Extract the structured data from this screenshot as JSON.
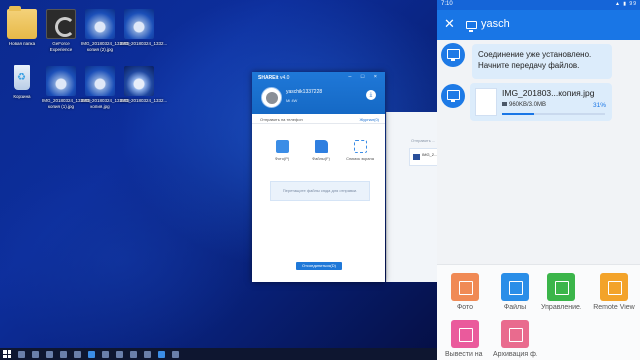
{
  "desktop": {
    "icons": [
      {
        "label": "Новая папка",
        "kind": "folder"
      },
      {
        "label": "GeForce Experience",
        "kind": "gfe"
      },
      {
        "label": "IMG_20180324_133208-копия (2).jpg",
        "kind": "photo"
      },
      {
        "label": "IMG_20180324_1332...",
        "kind": "photo"
      },
      {
        "label": "Корзина",
        "kind": "bin"
      },
      {
        "label": "IMG_20180324_133208-копия (1).jpg",
        "kind": "photo"
      },
      {
        "label": "IMG_20180324_133208-копия.jpg",
        "kind": "photo"
      },
      {
        "label": "IMG_20180324_1332...",
        "kind": "photo"
      }
    ]
  },
  "shareit": {
    "title": "SHAREit",
    "version": "v4.0",
    "controls": "– □ ×",
    "username": "yaschik1337228",
    "user_id": "Mi 4W",
    "receive_icon": "download-icon",
    "send_to_phone": "Отправить на телефон",
    "journal": "Журнал(0)",
    "actions": [
      {
        "label": "Фото(Р)",
        "icon": "photo-icon"
      },
      {
        "label": "Файлы(F)",
        "icon": "folder-icon"
      },
      {
        "label": "Снимок экрана",
        "icon": "screenshot-icon"
      }
    ],
    "drop_hint": "Перетащите файлы сюда для отправки.",
    "connected_btn": "Отсоединиться(D)"
  },
  "peek": {
    "label": "Отправить ...",
    "file": "IMG_2..."
  },
  "phone": {
    "status": {
      "time": "7:10",
      "icons": "▲ ▮ 99"
    },
    "peer_name": "yasch",
    "message": "Соединение уже установлено. Начните передачу файлов.",
    "file": {
      "name": "IMG_201803...копия.jpg",
      "size": "960KB/3.0MB",
      "percent_label": "31%",
      "progress": 0.31
    },
    "tray": [
      {
        "label": "Фото",
        "icon": "photo-icon",
        "color": "#f08a55"
      },
      {
        "label": "Файлы",
        "icon": "folder-icon",
        "color": "#2a8ee8"
      },
      {
        "label": "Управление...",
        "icon": "manage-icon",
        "color": "#3bb54a"
      },
      {
        "label": "Remote View",
        "icon": "remote-view-icon",
        "color": "#f3a32a"
      },
      {
        "label": "Вывести на ...",
        "icon": "print-icon",
        "color": "#ea5a9c"
      },
      {
        "label": "Архивация ф...",
        "icon": "archive-icon",
        "color": "#e96b8e"
      }
    ]
  }
}
